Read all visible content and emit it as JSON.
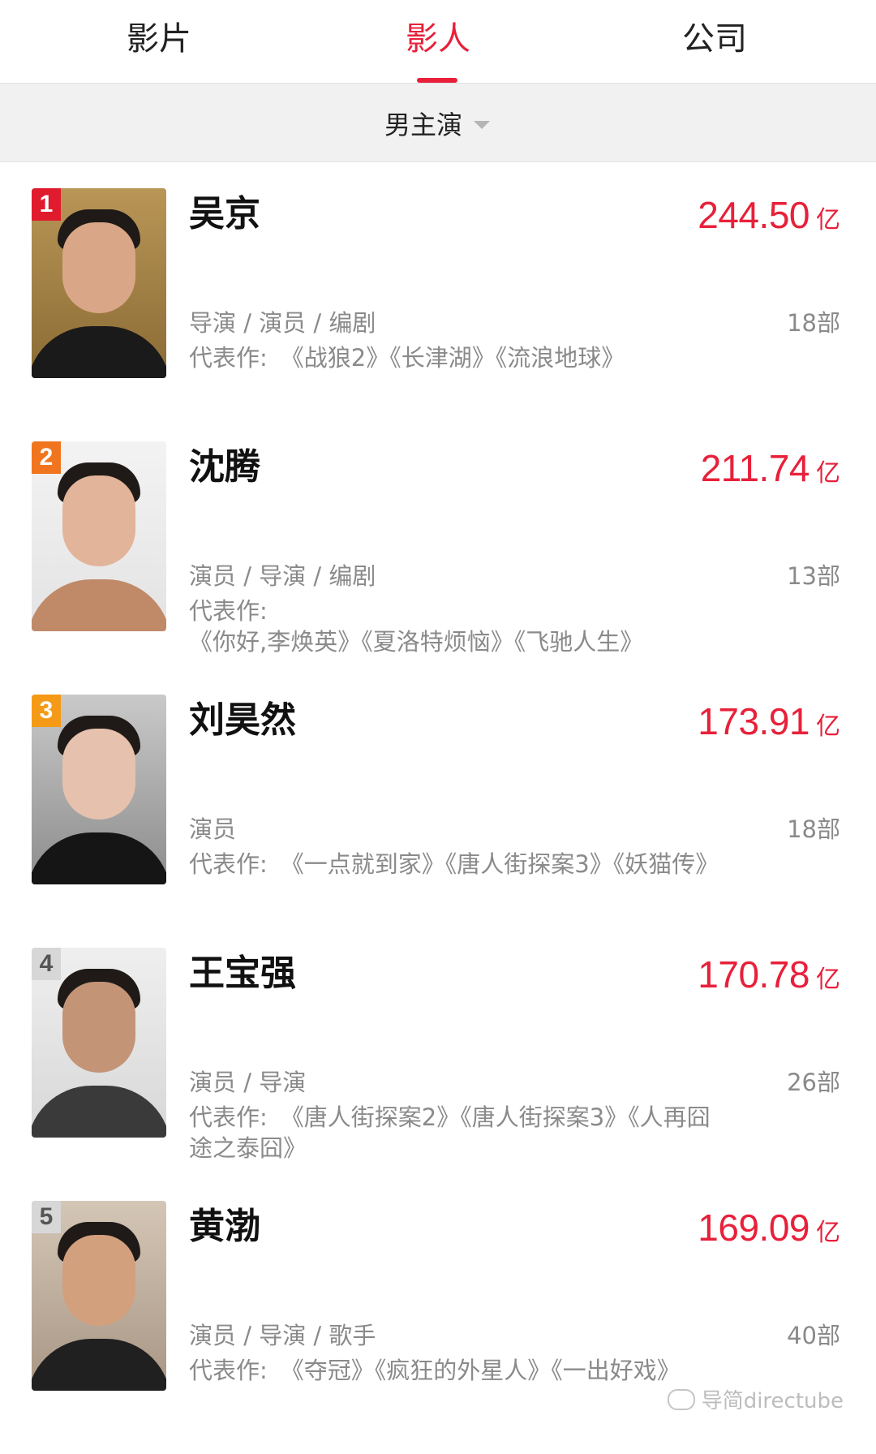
{
  "tabs": [
    {
      "label": "影片",
      "active": false
    },
    {
      "label": "影人",
      "active": true
    },
    {
      "label": "公司",
      "active": false
    }
  ],
  "accent_color": "#e8203a",
  "filter": {
    "label": "男主演",
    "icon": "caret-down-icon"
  },
  "people": [
    {
      "rank": "1",
      "name": "吴京",
      "gross_value": "244.50",
      "gross_unit": "亿",
      "roles": "导演 / 演员 / 编剧",
      "count": "18部",
      "works_label": "代表作:",
      "works": "《战狼2》《长津湖》《流浪地球》"
    },
    {
      "rank": "2",
      "name": "沈腾",
      "gross_value": "211.74",
      "gross_unit": "亿",
      "roles": "演员 / 导演 / 编剧",
      "count": "13部",
      "works_label": "代表作:",
      "works": "《你好,李焕英》《夏洛特烦恼》《飞驰人生》"
    },
    {
      "rank": "3",
      "name": "刘昊然",
      "gross_value": "173.91",
      "gross_unit": "亿",
      "roles": "演员",
      "count": "18部",
      "works_label": "代表作:",
      "works": "《一点就到家》《唐人街探案3》《妖猫传》"
    },
    {
      "rank": "4",
      "name": "王宝强",
      "gross_value": "170.78",
      "gross_unit": "亿",
      "roles": "演员 / 导演",
      "count": "26部",
      "works_label": "代表作:",
      "works": "《唐人街探案2》《唐人街探案3》《人再囧途之泰囧》"
    },
    {
      "rank": "5",
      "name": "黄渤",
      "gross_value": "169.09",
      "gross_unit": "亿",
      "roles": "演员 / 导演 / 歌手",
      "count": "40部",
      "works_label": "代表作:",
      "works": "《夺冠》《疯狂的外星人》《一出好戏》"
    }
  ],
  "watermark": "导简directube"
}
